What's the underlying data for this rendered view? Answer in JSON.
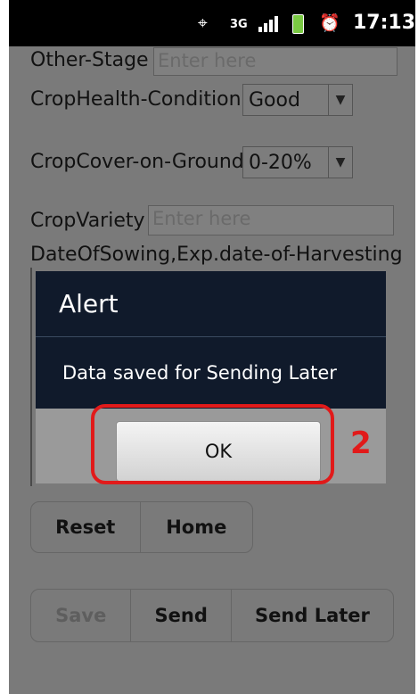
{
  "status_bar": {
    "time": "17:13",
    "network": "3G",
    "icons": [
      "gps-icon",
      "network-3g-icon",
      "signal-icon",
      "battery-icon",
      "alarm-icon"
    ]
  },
  "form": {
    "other_stage_label": "Other-Stage",
    "other_stage_placeholder": "Enter here",
    "crop_health_label": "CropHealth-Condition",
    "crop_health_value": "Good",
    "crop_cover_label": "CropCover-on-Ground",
    "crop_cover_value": "0-20%",
    "crop_variety_label": "CropVariety",
    "crop_variety_placeholder": "Enter here",
    "dates_label": "DateOfSowing,Exp.date-of-Harvesting"
  },
  "buttons": {
    "reset": "Reset",
    "home": "Home",
    "save": "Save",
    "send": "Send",
    "send_later": "Send Later"
  },
  "dialog": {
    "title": "Alert",
    "message": "Data saved for Sending Later",
    "ok_label": "OK"
  },
  "annotation": {
    "step_number": "2",
    "color": "#e11a1a"
  }
}
